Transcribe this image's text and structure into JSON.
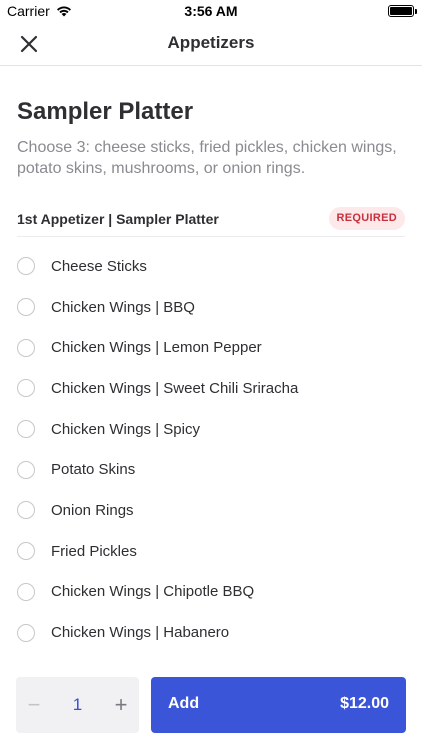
{
  "status_bar": {
    "carrier": "Carrier",
    "time": "3:56 AM",
    "battery_level": 1.0
  },
  "nav": {
    "title": "Appetizers",
    "close_icon": "close-icon"
  },
  "item": {
    "title": "Sampler Platter",
    "description": "Choose 3: cheese sticks, fried pickles, chicken wings, potato skins, mushrooms, or onion rings."
  },
  "section": {
    "title": "1st Appetizer | Sampler Platter",
    "badge": "REQUIRED"
  },
  "options": [
    "Cheese Sticks",
    "Chicken Wings | BBQ",
    "Chicken Wings | Lemon Pepper",
    "Chicken Wings | Sweet Chili Sriracha",
    "Chicken Wings | Spicy",
    "Potato Skins",
    "Onion Rings",
    "Fried Pickles",
    "Chicken Wings | Chipotle BBQ",
    "Chicken Wings | Habanero"
  ],
  "footer": {
    "minus": "−",
    "quantity": "1",
    "plus": "+",
    "add_label": "Add",
    "price": "$12.00"
  },
  "colors": {
    "accent": "#3b55d9",
    "badge_bg": "#fde8ea",
    "badge_text": "#c8303d"
  }
}
